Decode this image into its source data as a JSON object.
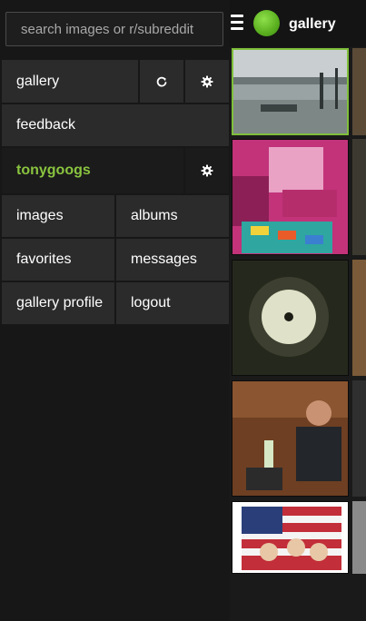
{
  "search": {
    "placeholder": "search images or r/subreddit"
  },
  "header": {
    "title": "gallery",
    "logo_color": "#5aaf1f"
  },
  "menu": {
    "gallery_label": "gallery",
    "feedback_label": "feedback",
    "user_label": "tonygoogs",
    "user_color": "#8ac43f",
    "links": [
      {
        "label": "images"
      },
      {
        "label": "albums"
      },
      {
        "label": "favorites"
      },
      {
        "label": "messages"
      },
      {
        "label": "gallery profile"
      },
      {
        "label": "logout"
      }
    ]
  },
  "icons": {
    "refresh": "refresh-icon",
    "settings": "gear-icon",
    "menu": "hamburger-icon"
  },
  "colors": {
    "accent": "#7fbf3a",
    "panel": "#2b2b2b",
    "background": "#171717"
  }
}
